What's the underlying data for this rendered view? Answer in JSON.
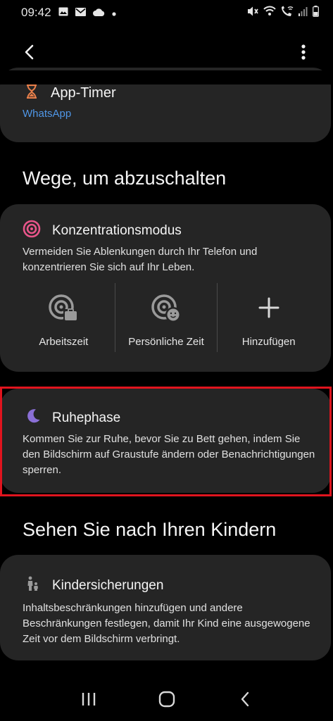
{
  "status_bar": {
    "time": "09:42",
    "left_icons": [
      "image-icon",
      "mail-icon",
      "cloud-icon",
      "dot-icon"
    ],
    "right_icons": [
      "mute-icon",
      "wifi-icon",
      "wifi-call-icon",
      "signal-icon",
      "battery-icon"
    ]
  },
  "app_bar": {
    "back_icon": "back-arrow-icon",
    "more_icon": "more-vert-icon"
  },
  "app_timer": {
    "title": "App-Timer",
    "icon": "hourglass-icon",
    "subtitle": "WhatsApp",
    "subtitle_color": "#4f96e6"
  },
  "section_disconnect": {
    "title": "Wege, um abzuschalten"
  },
  "focus_mode": {
    "title": "Konzentrationsmodus",
    "icon": "target-icon",
    "icon_color": "#e8558a",
    "description": "Vermeiden Sie Ablenkungen durch Ihr Telefon und konzentrieren Sie sich auf Ihr Leben.",
    "actions": [
      {
        "label": "Arbeitszeit",
        "icon": "work-focus-icon"
      },
      {
        "label": "Persönliche Zeit",
        "icon": "personal-focus-icon"
      },
      {
        "label": "Hinzufügen",
        "icon": "add-icon"
      }
    ]
  },
  "wind_down": {
    "title": "Ruhephase",
    "icon": "moon-icon",
    "icon_color": "#8a6fd6",
    "description": "Kommen Sie zur Ruhe, bevor Sie zu Bett gehen, indem Sie den Bildschirm auf Graustufe ändern oder Benachrichtigungen sperren.",
    "highlight_color": "#e0141e"
  },
  "section_children": {
    "title": "Sehen Sie nach Ihren Kindern"
  },
  "parental_controls": {
    "title": "Kindersicherungen",
    "icon": "parent-child-icon",
    "description": "Inhaltsbeschränkungen hinzufügen und andere Beschränkungen festlegen, damit Ihr Kind eine ausgewogene Zeit vor dem Bildschirm verbringt."
  },
  "nav_bar": {
    "items": [
      "recents-icon",
      "home-icon",
      "back-icon"
    ]
  }
}
